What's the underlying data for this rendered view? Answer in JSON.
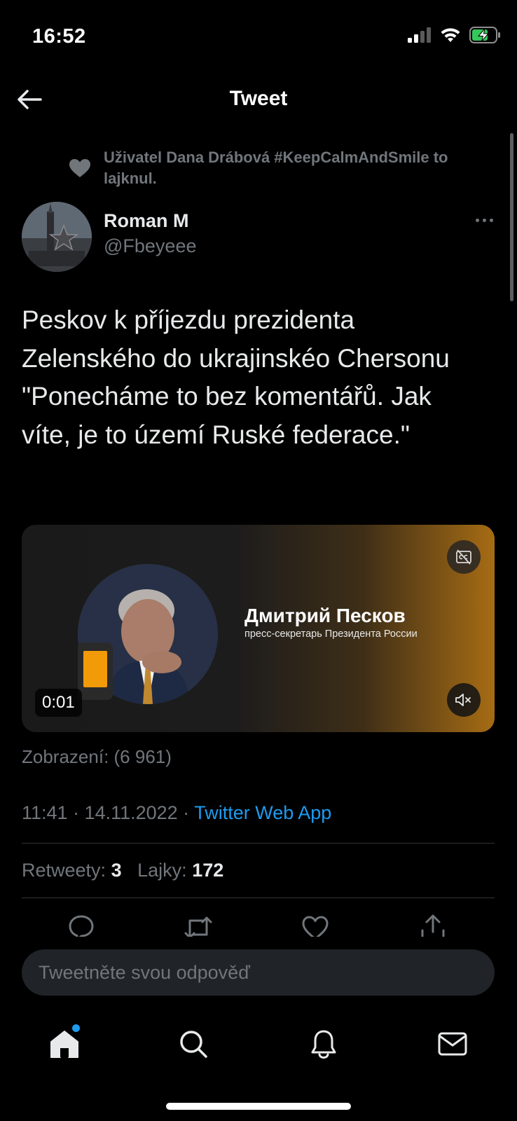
{
  "status_bar": {
    "time": "16:52",
    "icons": [
      "cellular-signal-icon",
      "wifi-icon",
      "battery-charging-icon"
    ]
  },
  "header": {
    "title": "Tweet",
    "back_icon": "arrow-left-icon"
  },
  "social_context": {
    "icon": "heart-icon",
    "text": "Uživatel Dana Drábová #KeepCalmAndSmile to lajknul."
  },
  "author": {
    "name": "Roman M",
    "handle": "@Fbeyeee",
    "more_icon": "more-horizontal-icon"
  },
  "tweet": {
    "text": "Peskov k příjezdu prezidenta Zelenského do ukrajinskéo Chersonu \"Ponecháme to bez komentářů. Jak víte, je to území Ruské federace.\""
  },
  "media": {
    "overlay_name": "Дмитрий Песков",
    "overlay_subtitle": "пресс-секретарь Президента России",
    "timecode": "0:01",
    "caption_icon": "closed-captions-icon",
    "mute_icon": "volume-muted-icon"
  },
  "views": "Zobrazení: (6 961)",
  "meta": {
    "datetime": "11:41 · 14.11.2022 · ",
    "source": "Twitter Web App"
  },
  "stats": {
    "retweets_label": "Retweety:",
    "retweets_value": "3",
    "likes_label": "Lajky:",
    "likes_value": "172"
  },
  "actions": [
    "reply-icon",
    "retweet-icon",
    "like-icon",
    "share-icon"
  ],
  "reply_box": {
    "placeholder": "Tweetněte svou odpověď"
  },
  "tabbar": {
    "items": [
      "home-icon",
      "search-icon",
      "notifications-icon",
      "messages-icon"
    ],
    "home_has_badge": true
  },
  "colors": {
    "background": "#000000",
    "text_primary": "#e7e9ea",
    "text_secondary": "#71767b",
    "accent": "#1d9bf0",
    "divider": "#2f3336",
    "input_bg": "#202327"
  }
}
